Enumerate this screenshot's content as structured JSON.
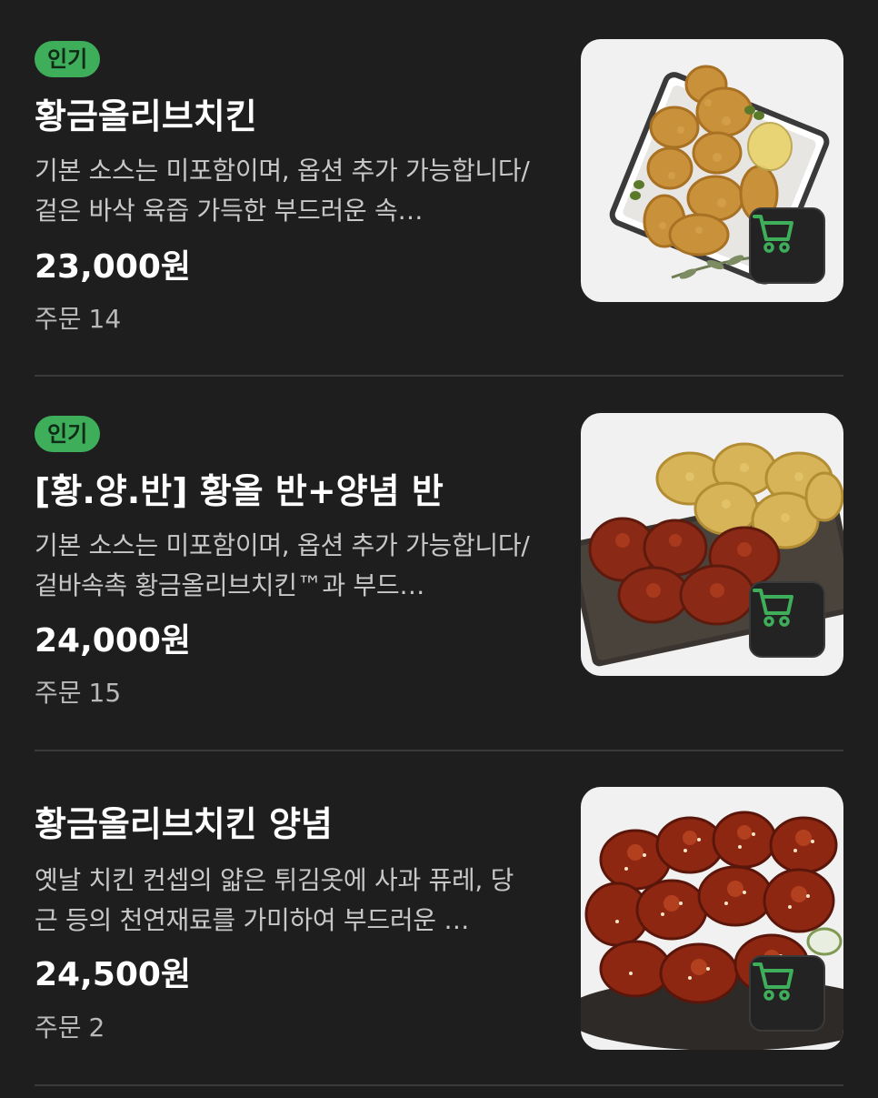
{
  "colors": {
    "background": "#1e1e1e",
    "badge": "#3fae5b",
    "cart_icon": "#3fae5b",
    "divider": "#3a3a3a"
  },
  "menu": {
    "items": [
      {
        "badge": "인기",
        "name": "황금올리브치킨",
        "description": "기본 소스는 미포함이며, 옵션 추가 가능합니다/겉은 바삭 육즙 가득한 부드러운 속…",
        "price": "23,000원",
        "orders_label": "주문",
        "orders_count": "14",
        "image_icon": "fried-chicken-image",
        "cart_icon": "cart-icon"
      },
      {
        "badge": "인기",
        "name": "[황.양.반] 황올 반+양념 반",
        "description": "기본 소스는 미포함이며, 옵션 추가 가능합니다/겉바속촉 황금올리브치킨™과 부드…",
        "price": "24,000원",
        "orders_label": "주문",
        "orders_count": "15",
        "image_icon": "half-half-chicken-image",
        "cart_icon": "cart-icon"
      },
      {
        "badge": "",
        "name": "황금올리브치킨 양념",
        "description": "옛날 치킨 컨셉의 얇은 튀김옷에 사과 퓨레, 당근 등의 천연재료를 가미하여 부드러운 …",
        "price": "24,500원",
        "orders_label": "주문",
        "orders_count": "2",
        "image_icon": "seasoned-chicken-image",
        "cart_icon": "cart-icon"
      }
    ]
  }
}
